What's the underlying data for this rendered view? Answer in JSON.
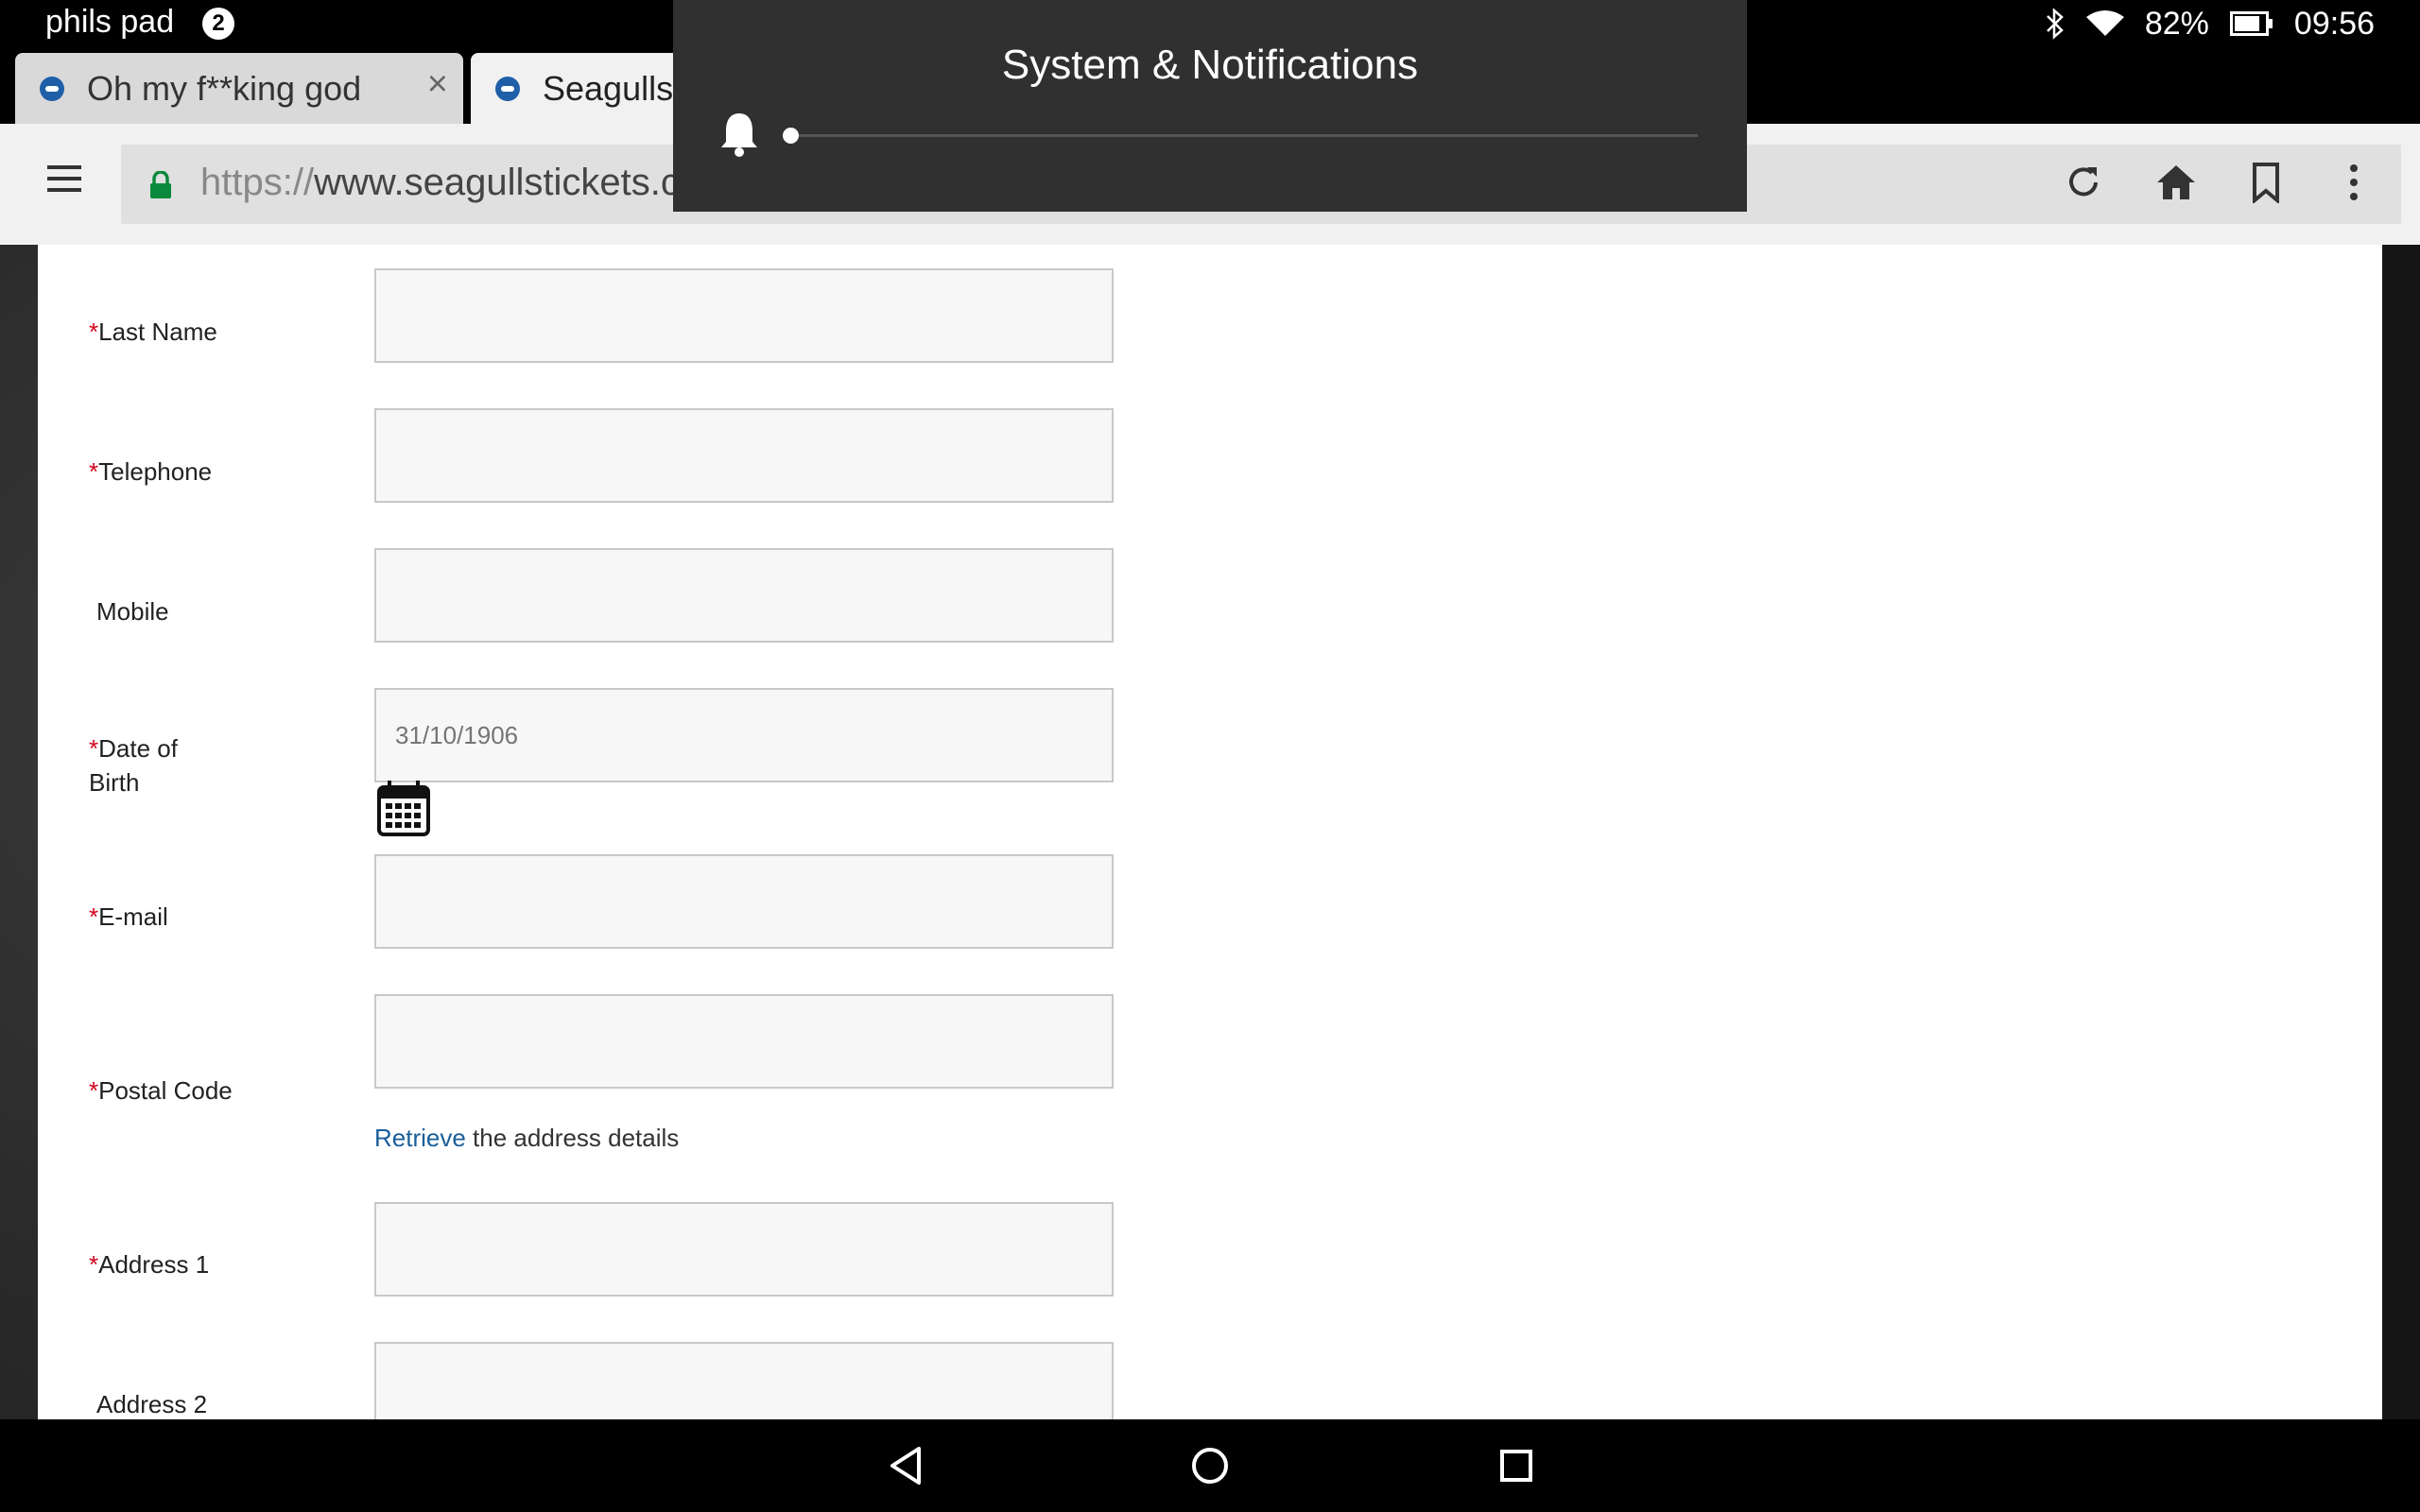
{
  "status_bar": {
    "device_name": "phils pad",
    "notification_count": "2",
    "battery": "82%",
    "time": "09:56",
    "icons": [
      "bluetooth-icon",
      "wifi-icon",
      "battery-icon"
    ]
  },
  "tabs": [
    {
      "title": "Oh my f**king god",
      "active": false
    },
    {
      "title": "Seagulls",
      "active": true
    }
  ],
  "toolbar": {
    "url_scheme": "https://",
    "url_rest": "www.seagullstickets.c",
    "icons": [
      "menu-icon",
      "lock-icon",
      "reload-icon",
      "home-icon",
      "bookmark-icon",
      "more-icon"
    ]
  },
  "notification_panel": {
    "title": "System & Notifications",
    "slider_level": 0
  },
  "form": {
    "fields": [
      {
        "label": "Last Name",
        "required": true,
        "value": ""
      },
      {
        "label": "Telephone",
        "required": true,
        "value": ""
      },
      {
        "label": "Mobile",
        "required": false,
        "value": ""
      },
      {
        "label_line1": "Date of",
        "label_line2": "Birth",
        "required": true,
        "placeholder": "31/10/1906"
      },
      {
        "label": "E-mail",
        "required": true,
        "value": ""
      },
      {
        "label": "Postal Code",
        "required": true,
        "value": ""
      },
      {
        "label": "Address 1",
        "required": true,
        "value": ""
      },
      {
        "label": "Address 2",
        "required": false,
        "value": ""
      }
    ],
    "required_mark": "*",
    "retrieve_link": "Retrieve",
    "retrieve_rest": " the address details"
  },
  "colors": {
    "required": "#d0021b",
    "link": "#1a5e9a",
    "lock": "#0a8a3a"
  }
}
